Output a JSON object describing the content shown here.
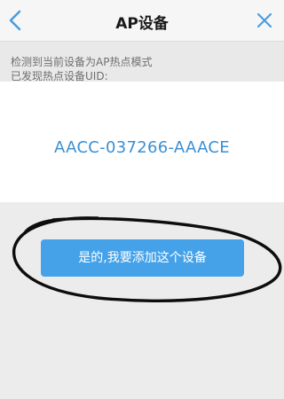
{
  "header": {
    "title": "AP设备",
    "back_icon": "chevron-left-icon",
    "close_icon": "close-icon"
  },
  "info": {
    "line1": "检测到当前设备为AP热点模式",
    "line2": "已发现热点设备UID:"
  },
  "device": {
    "uid": "AACC-037266-AAACE"
  },
  "actions": {
    "add_button_label": "是的,我要添加这个设备"
  },
  "colors": {
    "accent": "#3a8fd3",
    "button": "#45a2e9",
    "header_bg": "#f6f6f6",
    "page_bg": "#ececec"
  }
}
